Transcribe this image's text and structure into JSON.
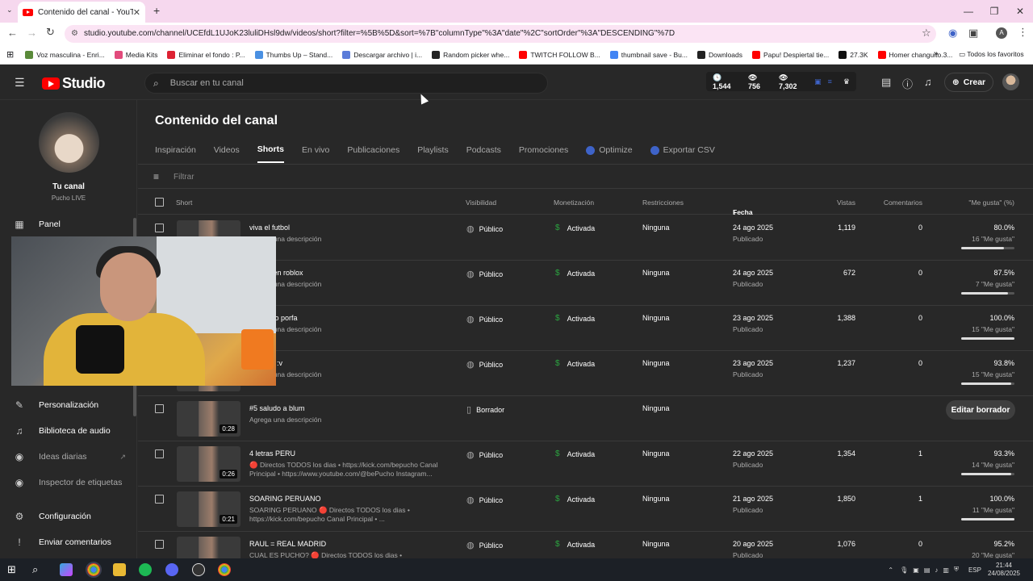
{
  "browser": {
    "tab_title": "Contenido del canal - YouTube",
    "url": "studio.youtube.com/channel/UCEfdL1UJoK23luliDHsl9dw/videos/short?filter=%5B%5D&sort=%7B\"columnType\"%3A\"date\"%2C\"sortOrder\"%3A\"DESCENDING\"%7D",
    "bookmarks": [
      {
        "label": "Voz masculina - Enri...",
        "color": "#5a8a3a"
      },
      {
        "label": "Media Kits",
        "color": "#e24b7c"
      },
      {
        "label": "Eliminar el fondo : P...",
        "color": "#d23"
      },
      {
        "label": "Thumbs Up – Stand...",
        "color": "#4a90e2"
      },
      {
        "label": "Descargar archivo | i...",
        "color": "#5b7cd9"
      },
      {
        "label": "Random picker whe...",
        "color": "#222"
      },
      {
        "label": "TWITCH FOLLOW B...",
        "color": "#f00"
      },
      {
        "label": "thumbnail save - Bu...",
        "color": "#4285f4"
      },
      {
        "label": "Downloads",
        "color": "#222"
      },
      {
        "label": "Papu! Despiertal tie...",
        "color": "#f00"
      },
      {
        "label": "27.3K",
        "color": "#111"
      },
      {
        "label": "Homer changuito.3...",
        "color": "#f00"
      }
    ],
    "bookmarks_folder": "Todos los favoritos"
  },
  "header": {
    "brand": "Studio",
    "search_placeholder": "Buscar en tu canal",
    "stats": {
      "a": "1,544",
      "b": "756",
      "c": "7,302"
    },
    "create_label": "Crear"
  },
  "sidebar": {
    "channel_name": "Tu canal",
    "channel_handle": "Pucho LIVE",
    "items": [
      {
        "label": "Panel",
        "icon": "dashboard-icon"
      },
      {
        "label": "Personalización",
        "icon": "customization-icon"
      },
      {
        "label": "Biblioteca de audio",
        "icon": "audio-library-icon"
      },
      {
        "label": "Ideas diarias",
        "icon": "ideas-icon"
      },
      {
        "label": "Inspector de etiquetas",
        "icon": "tag-inspector-icon"
      },
      {
        "label": "Configuración",
        "icon": "settings-icon"
      },
      {
        "label": "Enviar comentarios",
        "icon": "feedback-icon"
      }
    ]
  },
  "main": {
    "title": "Contenido del canal",
    "tabs": [
      "Inspiración",
      "Videos",
      "Shorts",
      "En vivo",
      "Publicaciones",
      "Playlists",
      "Podcasts",
      "Promociones",
      "Optimize",
      "Exportar CSV"
    ],
    "active_tab": "Shorts",
    "filter_placeholder": "Filtrar",
    "columns": {
      "short": "Short",
      "visibility": "Visibilidad",
      "monetization": "Monetización",
      "restrictions": "Restricciones",
      "date": "Fecha",
      "views": "Vistas",
      "comments": "Comentarios",
      "likes": "\"Me gusta\" (%)"
    },
    "rows": [
      {
        "title": "viva el futbol",
        "desc": "Agrega una descripción",
        "visibility": "Público",
        "monetization": "Activada",
        "restrictions": "Ninguna",
        "date": "24 ago 2025",
        "status": "Publicado",
        "views": "1,119",
        "comments": "0",
        "pct": "80.0%",
        "likes": "16 \"Me gusta\"",
        "ratio": 0.8,
        "duration": ""
      },
      {
        "title": "ues 63 en roblox",
        "desc": "Agrega una descripción",
        "visibility": "Público",
        "monetization": "Activada",
        "restrictions": "Ninguna",
        "date": "24 ago 2025",
        "status": "Publicado",
        "views": "672",
        "comments": "0",
        "pct": "87.5%",
        "likes": "7 \"Me gusta\"",
        "ratio": 0.875,
        "duration": ""
      },
      {
        "title": "a bailarlo porfa",
        "desc": "Agrega una descripción",
        "visibility": "Público",
        "monetization": "Activada",
        "restrictions": "Ninguna",
        "date": "23 ago 2025",
        "status": "Publicado",
        "views": "1,388",
        "comments": "0",
        "pct": "100.0%",
        "likes": "15 \"Me gusta\"",
        "ratio": 1.0,
        "duration": ""
      },
      {
        "title": "un pollo :v",
        "desc": "Agrega una descripción",
        "visibility": "Público",
        "monetization": "Activada",
        "restrictions": "Ninguna",
        "date": "23 ago 2025",
        "status": "Publicado",
        "views": "1,237",
        "comments": "0",
        "pct": "93.8%",
        "likes": "15 \"Me gusta\"",
        "ratio": 0.938,
        "duration": ""
      },
      {
        "title": "#5 saludo a blum",
        "desc": "Agrega una descripción",
        "visibility": "Borrador",
        "monetization": "",
        "restrictions": "Ninguna",
        "date": "",
        "status": "",
        "views": "",
        "comments": "",
        "pct": "",
        "likes": "",
        "ratio": 0,
        "duration": "0:28",
        "draft_button": "Editar borrador"
      },
      {
        "title": "4 letras PERU",
        "desc": "🔴 Directos TODOS los dias • https://kick.com/bepucho Canal Principal • https://www.youtube.com/@bePucho Instagram...",
        "visibility": "Público",
        "monetization": "Activada",
        "restrictions": "Ninguna",
        "date": "22 ago 2025",
        "status": "Publicado",
        "views": "1,354",
        "comments": "1",
        "pct": "93.3%",
        "likes": "14 \"Me gusta\"",
        "ratio": 0.933,
        "duration": "0:26"
      },
      {
        "title": "SOARING PERUANO",
        "desc": "SOARING PERUANO 🔴 Directos TODOS los dias • https://kick.com/bepucho Canal Principal • ...",
        "visibility": "Público",
        "monetization": "Activada",
        "restrictions": "Ninguna",
        "date": "21 ago 2025",
        "status": "Publicado",
        "views": "1,850",
        "comments": "1",
        "pct": "100.0%",
        "likes": "11 \"Me gusta\"",
        "ratio": 1.0,
        "duration": "0:21"
      },
      {
        "title": "RAUL = REAL MADRID",
        "desc": "CUAL ES PUCHO? 🔴 Directos TODOS los dias •",
        "visibility": "Público",
        "monetization": "Activada",
        "restrictions": "Ninguna",
        "date": "20 ago 2025",
        "status": "Publicado",
        "views": "1,076",
        "comments": "0",
        "pct": "95.2%",
        "likes": "20 \"Me gusta\"",
        "ratio": 0.952,
        "duration": ""
      }
    ]
  },
  "taskbar": {
    "lang": "ESP",
    "time": "21:44",
    "date": "24/08/2025"
  }
}
